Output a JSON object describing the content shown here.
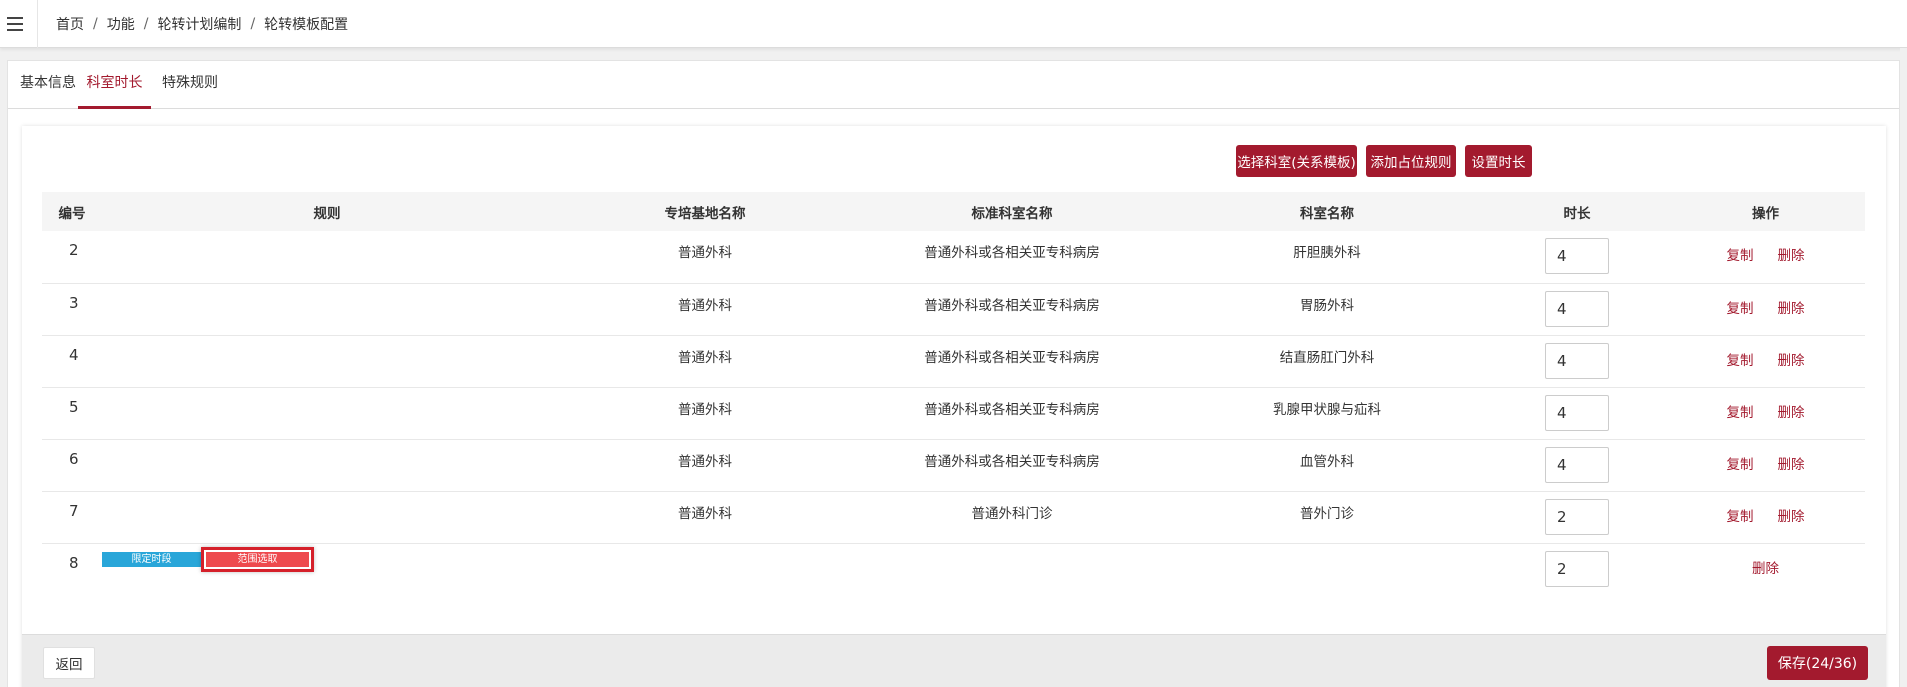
{
  "breadcrumb": [
    "首页",
    "功能",
    "轮转计划编制",
    "轮转模板配置"
  ],
  "breadcrumb_separator": "/",
  "tabs": [
    {
      "label": "基本信息",
      "active": false
    },
    {
      "label": "科室时长",
      "active": true
    },
    {
      "label": "特殊规则",
      "active": false
    }
  ],
  "toolbar": {
    "select_dept_label": "选择科室(关系模板)",
    "add_placeholder_rule_label": "添加占位规则",
    "set_duration_label": "设置时长"
  },
  "table": {
    "columns": [
      "编号",
      "规则",
      "专培基地名称",
      "标准科室名称",
      "科室名称",
      "时长",
      "操作"
    ],
    "rows": [
      {
        "no": "2",
        "base": "普通外科",
        "std_dept": "普通外科或各相关亚专科病房",
        "dept": "肝胆胰外科",
        "duration": "4"
      },
      {
        "no": "3",
        "base": "普通外科",
        "std_dept": "普通外科或各相关亚专科病房",
        "dept": "胃肠外科",
        "duration": "4"
      },
      {
        "no": "4",
        "base": "普通外科",
        "std_dept": "普通外科或各相关亚专科病房",
        "dept": "结直肠肛门外科",
        "duration": "4"
      },
      {
        "no": "5",
        "base": "普通外科",
        "std_dept": "普通外科或各相关亚专科病房",
        "dept": "乳腺甲状腺与疝科",
        "duration": "4"
      },
      {
        "no": "6",
        "base": "普通外科",
        "std_dept": "普通外科或各相关亚专科病房",
        "dept": "血管外科",
        "duration": "4"
      },
      {
        "no": "7",
        "base": "普通外科",
        "std_dept": "普通外科门诊",
        "dept": "普外门诊",
        "duration": "2"
      }
    ],
    "rule_row": {
      "no": "8",
      "tag_period": "限定时段",
      "tag_range": "范围选取",
      "duration": "2"
    },
    "copy_label": "复制",
    "delete_label": "删除"
  },
  "footer": {
    "back_label": "返回",
    "save_label": "保存(24/36)"
  },
  "colors": {
    "accent": "#a31a2e",
    "tag_blue": "#29a6d9",
    "tag_red": "#ee4a4e"
  }
}
